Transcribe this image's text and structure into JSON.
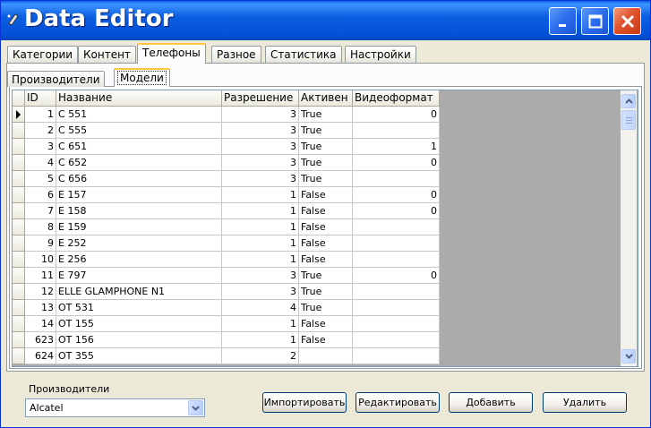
{
  "window": {
    "title": "Data Editor"
  },
  "tabs": {
    "main": [
      {
        "label": "Категории"
      },
      {
        "label": "Контент"
      },
      {
        "label": "Телефоны"
      },
      {
        "label": "Разное"
      },
      {
        "label": "Статистика"
      },
      {
        "label": "Настройки"
      }
    ],
    "sub": [
      {
        "label": "Производители"
      },
      {
        "label": "Модели"
      }
    ]
  },
  "grid": {
    "columns": [
      "ID",
      "Название",
      "Разрешение",
      "Активен",
      "Видеоформат"
    ],
    "rows": [
      {
        "id": "1",
        "name": "C 551",
        "res": "3",
        "active": "True",
        "video": "0"
      },
      {
        "id": "2",
        "name": "C 555",
        "res": "3",
        "active": "True",
        "video": ""
      },
      {
        "id": "3",
        "name": "C 651",
        "res": "3",
        "active": "True",
        "video": "1"
      },
      {
        "id": "4",
        "name": "C 652",
        "res": "3",
        "active": "True",
        "video": "0"
      },
      {
        "id": "5",
        "name": "C 656",
        "res": "3",
        "active": "True",
        "video": ""
      },
      {
        "id": "6",
        "name": "E 157",
        "res": "1",
        "active": "False",
        "video": "0"
      },
      {
        "id": "7",
        "name": "E 158",
        "res": "1",
        "active": "False",
        "video": "0"
      },
      {
        "id": "8",
        "name": "E 159",
        "res": "1",
        "active": "False",
        "video": ""
      },
      {
        "id": "9",
        "name": "E 252",
        "res": "1",
        "active": "False",
        "video": ""
      },
      {
        "id": "10",
        "name": "E 256",
        "res": "1",
        "active": "False",
        "video": ""
      },
      {
        "id": "11",
        "name": "E 797",
        "res": "3",
        "active": "True",
        "video": "0"
      },
      {
        "id": "12",
        "name": "ELLE GLAMPHONE N1",
        "res": "3",
        "active": "True",
        "video": ""
      },
      {
        "id": "13",
        "name": "OT 531",
        "res": "4",
        "active": "True",
        "video": ""
      },
      {
        "id": "14",
        "name": "OT 155",
        "res": "1",
        "active": "False",
        "video": ""
      },
      {
        "id": "623",
        "name": "OT 156",
        "res": "1",
        "active": "False",
        "video": ""
      },
      {
        "id": "624",
        "name": "OT 355",
        "res": "2",
        "active": "",
        "video": ""
      }
    ]
  },
  "footer": {
    "producers_label": "Производители",
    "producers_value": "Alcatel",
    "import_label": "Импортировать",
    "edit_label": "Редактировать",
    "add_label": "Добавить",
    "delete_label": "Удалить"
  }
}
